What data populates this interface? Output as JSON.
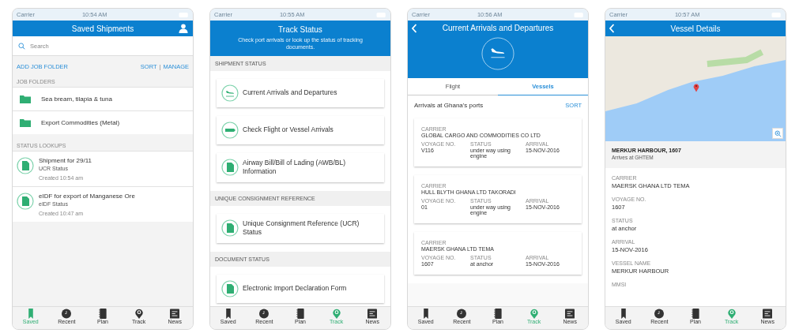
{
  "screens": [
    {
      "kind": "saved",
      "status_bar": {
        "carrier": "Carrier",
        "time": "10:54 AM"
      },
      "title": "Saved Shipments",
      "search": {
        "placeholder": "Search"
      },
      "actions": {
        "add": "ADD JOB FOLDER",
        "sort": "SORT",
        "separator": "|",
        "manage": "MANAGE"
      },
      "folders": {
        "heading": "JOB FOLDERS",
        "items": [
          "Sea bream, tilapia & tuna",
          "Export Commodities (Metal)"
        ]
      },
      "lookups": {
        "heading": "STATUS LOOKUPS",
        "items": [
          {
            "title": "Shipment for 29/11",
            "subtitle": "UCR Status",
            "created": "Created 10:54 am"
          },
          {
            "title": "eIDF for export of Manganese Ore",
            "subtitle": "eIDF Status",
            "created": "Created 10:47 am"
          }
        ]
      },
      "tabs": [
        {
          "label": "Saved",
          "selected": true
        },
        {
          "label": "Recent",
          "selected": false
        },
        {
          "label": "Plan",
          "selected": false
        },
        {
          "label": "Track",
          "selected": false
        },
        {
          "label": "News",
          "selected": false
        }
      ]
    },
    {
      "kind": "track",
      "status_bar": {
        "carrier": "Carrier",
        "time": "10:55 AM"
      },
      "title": "Track Status",
      "subtitle": "Check port arrivals or look up the status of tracking documents.",
      "sections": [
        {
          "heading": "SHIPMENT STATUS",
          "items": [
            {
              "kind": "plane",
              "label": "Current Arrivals and Departures"
            },
            {
              "kind": "ticket",
              "label": "Check Flight or Vessel Arrivals"
            },
            {
              "kind": "document",
              "label": "Airway Bill/Bill of Lading (AWB/BL) Information"
            }
          ]
        },
        {
          "heading": "UNIQUE CONSIGNMENT REFERENCE",
          "items": [
            {
              "kind": "document",
              "label": "Unique Consignment Reference (UCR) Status"
            }
          ]
        },
        {
          "heading": "DOCUMENT STATUS",
          "items": [
            {
              "kind": "document",
              "label": "Electronic Import Declaration Form"
            }
          ]
        }
      ],
      "tabs": [
        {
          "label": "Saved",
          "selected": false
        },
        {
          "label": "Recent",
          "selected": false
        },
        {
          "label": "Plan",
          "selected": false
        },
        {
          "label": "Track",
          "selected": true
        },
        {
          "label": "News",
          "selected": false
        }
      ]
    },
    {
      "kind": "arrivals",
      "status_bar": {
        "carrier": "Carrier",
        "time": "10:56 AM"
      },
      "title": "Current Arrivals and Departures",
      "segments": [
        {
          "label": "Flight",
          "selected": false
        },
        {
          "label": "Vessels",
          "selected": true
        }
      ],
      "list_title": "Arrivals at Ghana's ports",
      "sort": "SORT",
      "cards": [
        {
          "carrier_label": "CARRIER",
          "carrier": "GLOBAL CARGO AND COMMODITIES CO LTD",
          "fields": [
            {
              "label": "VOYAGE NO.",
              "value": "V116"
            },
            {
              "label": "STATUS",
              "value": "under way using engine"
            },
            {
              "label": "ARRIVAL",
              "value": "15-NOV-2016"
            }
          ]
        },
        {
          "carrier_label": "CARRIER",
          "carrier": "HULL BLYTH GHANA LTD TAKORADI",
          "fields": [
            {
              "label": "VOYAGE NO.",
              "value": "01"
            },
            {
              "label": "STATUS",
              "value": "under way using engine"
            },
            {
              "label": "ARRIVAL",
              "value": "15-NOV-2016"
            }
          ]
        },
        {
          "carrier_label": "CARRIER",
          "carrier": "MAERSK GHANA LTD TEMA",
          "fields": [
            {
              "label": "VOYAGE NO.",
              "value": "1607"
            },
            {
              "label": "STATUS",
              "value": "at anchor"
            },
            {
              "label": "ARRIVAL",
              "value": "15-NOV-2016"
            }
          ]
        }
      ],
      "tabs": [
        {
          "label": "Saved",
          "selected": false
        },
        {
          "label": "Recent",
          "selected": false
        },
        {
          "label": "Plan",
          "selected": false
        },
        {
          "label": "Track",
          "selected": true
        },
        {
          "label": "News",
          "selected": false
        }
      ]
    },
    {
      "kind": "details",
      "status_bar": {
        "carrier": "Carrier",
        "time": "10:57 AM"
      },
      "title": "Vessel Details",
      "vessel": "MERKUR HARBOUR, 1607",
      "arrives": "Arrives at GHTEM",
      "fields": [
        {
          "label": "CARRIER",
          "value": "MAERSK GHANA LTD TEMA"
        },
        {
          "label": "VOYAGE NO.",
          "value": "1607"
        },
        {
          "label": "STATUS",
          "value": "at anchor"
        },
        {
          "label": "ARRIVAL",
          "value": "15-NOV-2016"
        },
        {
          "label": "VESSEL NAME",
          "value": "MERKUR HARBOUR"
        },
        {
          "label": "MMSI"
        }
      ],
      "tabs": [
        {
          "label": "Saved",
          "selected": false
        },
        {
          "label": "Recent",
          "selected": false
        },
        {
          "label": "Plan",
          "selected": false
        },
        {
          "label": "Track",
          "selected": true
        },
        {
          "label": "News",
          "selected": false
        }
      ]
    }
  ]
}
